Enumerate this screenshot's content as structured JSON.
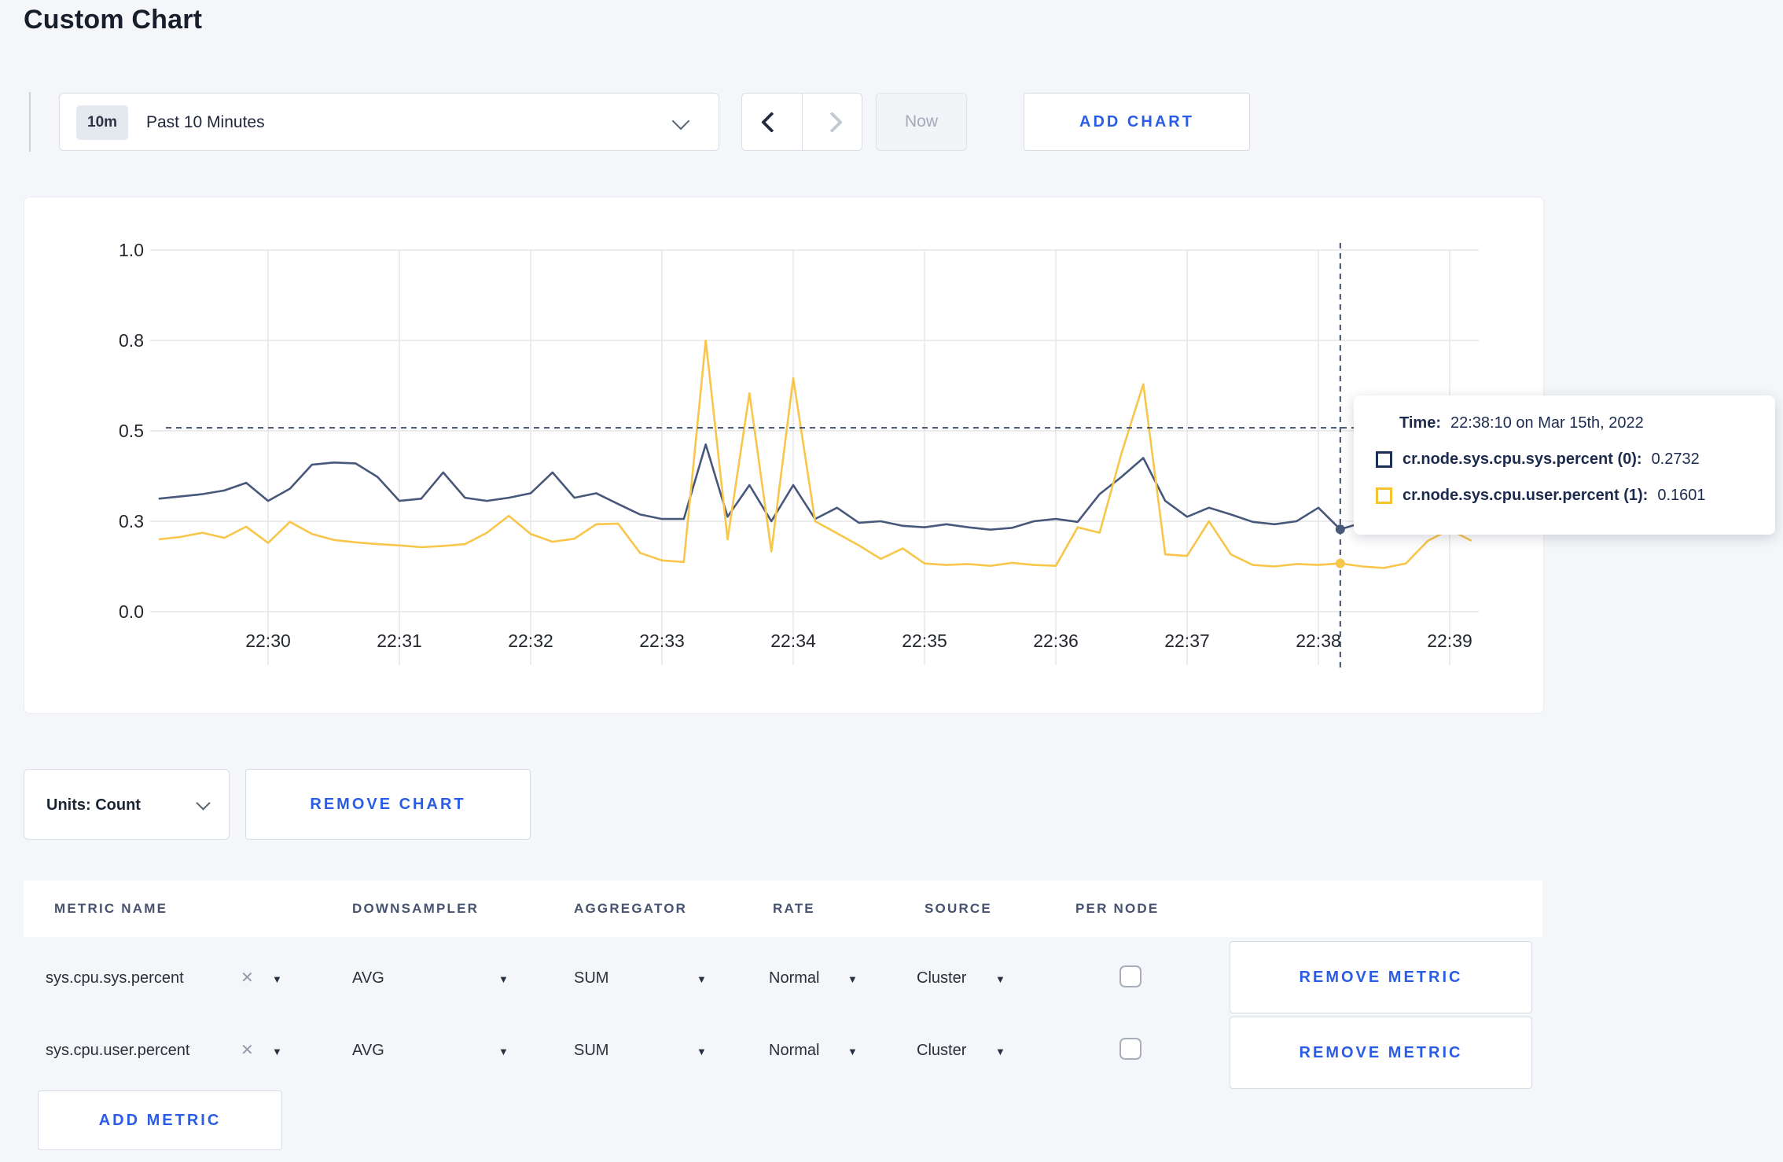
{
  "page": {
    "title": "Custom Chart",
    "background": "#f4f6f9"
  },
  "icons": {
    "caret_down": "▼",
    "close_x": "✕",
    "range_dropdown": "chevron-down-icon",
    "prev": "chevron-left-icon",
    "next": "chevron-right-icon"
  },
  "colors": {
    "accent_blue": "#2a5ce6",
    "series_sys": "#48587a",
    "series_user": "#f7c64a",
    "crosshair": "#3e506c",
    "grid": "#e6e6e6",
    "tick_text": "#24282f",
    "tooltip_text": "#1c2b4d"
  },
  "toolbar": {
    "range_badge": "10m",
    "range_label": "Past 10 Minutes",
    "now_label": "Now",
    "add_chart_label": "ADD CHART"
  },
  "chart_data": {
    "type": "line",
    "title": "",
    "xlabel": "",
    "ylabel": "",
    "x_start": "22:29:10",
    "x_end": "22:39:10",
    "x_interval_seconds": 10,
    "xticks": [
      "22:30",
      "22:31",
      "22:32",
      "22:33",
      "22:34",
      "22:35",
      "22:36",
      "22:37",
      "22:38",
      "22:39"
    ],
    "yticks": [
      0.0,
      0.3,
      0.5,
      0.8,
      1.0
    ],
    "ylim": [
      0,
      1.0
    ],
    "grid": true,
    "legend_position": "tooltip",
    "series": [
      {
        "name": "cr.node.sys.cpu.sys.percent",
        "color": "#48587a",
        "values": [
          0.35,
          0.355,
          0.36,
          0.368,
          0.385,
          0.345,
          0.372,
          0.425,
          0.43,
          0.428,
          0.398,
          0.345,
          0.35,
          0.408,
          0.352,
          0.345,
          0.352,
          0.362,
          0.408,
          0.352,
          0.362,
          0.338,
          0.315,
          0.305,
          0.305,
          0.47,
          0.31,
          0.38,
          0.3,
          0.38,
          0.305,
          0.33,
          0.295,
          0.3,
          0.285,
          0.28,
          0.29,
          0.28,
          0.272,
          0.278,
          0.3,
          0.305,
          0.298,
          0.36,
          0.398,
          0.44,
          0.345,
          0.31,
          0.33,
          0.315,
          0.298,
          0.29,
          0.3,
          0.33,
          0.2732,
          0.295,
          0.305,
          0.298,
          0.305,
          0.298,
          0.3
        ]
      },
      {
        "name": "cr.node.sys.cpu.user.percent",
        "color": "#f7c64a",
        "values": [
          0.24,
          0.248,
          0.262,
          0.245,
          0.282,
          0.228,
          0.298,
          0.258,
          0.238,
          0.23,
          0.224,
          0.22,
          0.214,
          0.218,
          0.224,
          0.262,
          0.312,
          0.258,
          0.232,
          0.242,
          0.29,
          0.292,
          0.195,
          0.17,
          0.165,
          0.8,
          0.24,
          0.625,
          0.2,
          0.675,
          0.3,
          0.26,
          0.22,
          0.175,
          0.21,
          0.16,
          0.155,
          0.158,
          0.152,
          0.162,
          0.155,
          0.152,
          0.28,
          0.262,
          0.45,
          0.655,
          0.19,
          0.185,
          0.3,
          0.19,
          0.155,
          0.15,
          0.158,
          0.155,
          0.1601,
          0.15,
          0.145,
          0.16,
          0.235,
          0.272,
          0.235
        ]
      }
    ],
    "crosshair": {
      "time": "22:38:10",
      "x_index": 54,
      "guide_y_value": 0.51,
      "points": [
        {
          "series": "cr.node.sys.cpu.sys.percent",
          "value": 0.2732
        },
        {
          "series": "cr.node.sys.cpu.user.percent",
          "value": 0.1601
        }
      ]
    }
  },
  "tooltip": {
    "time_label": "Time:",
    "time_value": "22:38:10 on Mar 15th, 2022",
    "series": [
      {
        "label": "cr.node.sys.cpu.sys.percent (0):",
        "value": "0.2732"
      },
      {
        "label": "cr.node.sys.cpu.user.percent (1):",
        "value": "0.1601"
      }
    ]
  },
  "chart_controls": {
    "units_label": "Units: Count",
    "remove_chart_label": "REMOVE CHART"
  },
  "metrics_table": {
    "headers": [
      "METRIC NAME",
      "DOWNSAMPLER",
      "AGGREGATOR",
      "RATE",
      "SOURCE",
      "PER NODE"
    ],
    "rows": [
      {
        "name": "sys.cpu.sys.percent",
        "downsampler": "AVG",
        "aggregator": "SUM",
        "rate": "Normal",
        "source": "Cluster",
        "per_node_checked": false
      },
      {
        "name": "sys.cpu.user.percent",
        "downsampler": "AVG",
        "aggregator": "SUM",
        "rate": "Normal",
        "source": "Cluster",
        "per_node_checked": false
      }
    ],
    "remove_metric_label": "REMOVE METRIC",
    "add_metric_label": "ADD METRIC"
  }
}
